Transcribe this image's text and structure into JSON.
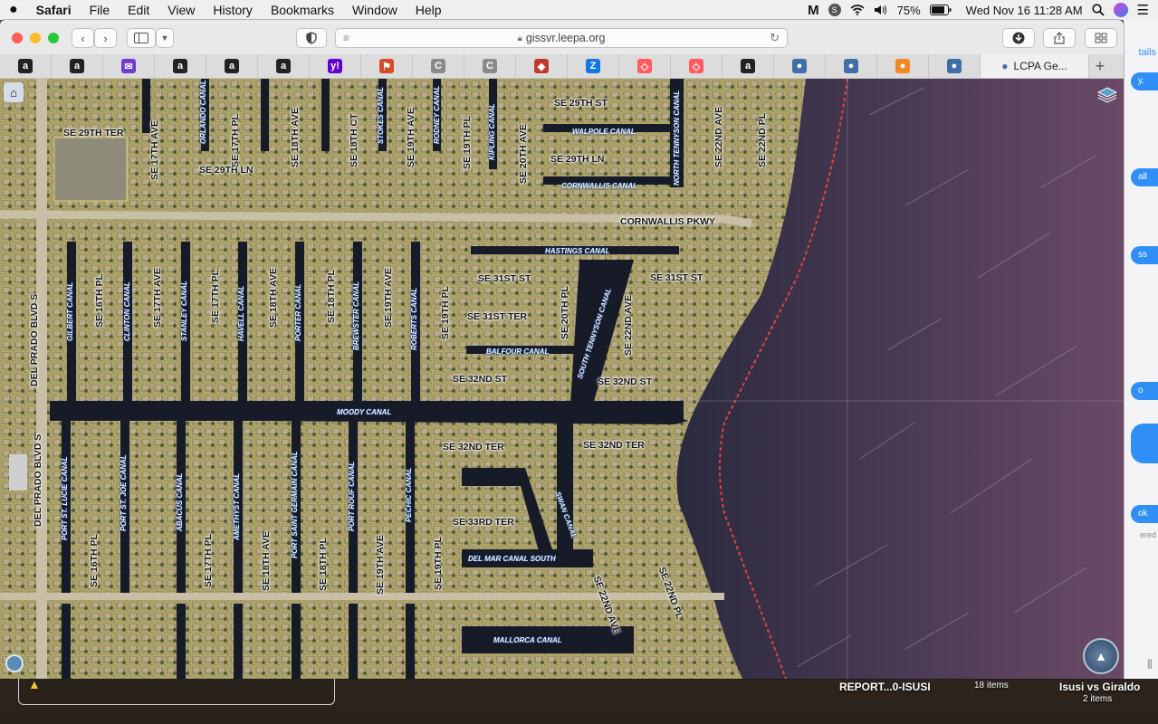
{
  "menubar": {
    "app_name": "Safari",
    "menus": [
      "File",
      "Edit",
      "View",
      "History",
      "Bookmarks",
      "Window",
      "Help"
    ],
    "battery": "75%",
    "clock": "Wed Nov 16  11:28 AM"
  },
  "browser": {
    "url": "gissvr.leepa.org",
    "active_tab_label": "LCPA Ge...",
    "favorites": [
      {
        "icon": "amazon-icon",
        "glyph": "a",
        "color": "#222222"
      },
      {
        "icon": "amazon-icon",
        "glyph": "a",
        "color": "#222222"
      },
      {
        "icon": "mail-icon",
        "glyph": "✉",
        "color": "#6f3bd1"
      },
      {
        "icon": "amazon-icon",
        "glyph": "a",
        "color": "#222222"
      },
      {
        "icon": "amazon-icon",
        "glyph": "a",
        "color": "#222222"
      },
      {
        "icon": "amazon-icon",
        "glyph": "a",
        "color": "#222222"
      },
      {
        "icon": "yahoo-icon",
        "glyph": "y!",
        "color": "#6001d2"
      },
      {
        "icon": "news-icon",
        "glyph": "⚑",
        "color": "#d94a2b"
      },
      {
        "icon": "c-icon",
        "glyph": "C",
        "color": "#8a8a8a"
      },
      {
        "icon": "c-icon",
        "glyph": "C",
        "color": "#8a8a8a"
      },
      {
        "icon": "cube-icon",
        "glyph": "◆",
        "color": "#c0392b"
      },
      {
        "icon": "zillow-icon",
        "glyph": "Z",
        "color": "#1277e1"
      },
      {
        "icon": "airbnb-icon",
        "glyph": "◇",
        "color": "#ff5a5f"
      },
      {
        "icon": "airbnb-icon",
        "glyph": "◇",
        "color": "#ff5a5f"
      },
      {
        "icon": "amazon-icon",
        "glyph": "a",
        "color": "#222222"
      },
      {
        "icon": "globe-icon",
        "glyph": "●",
        "color": "#3d6fa6"
      },
      {
        "icon": "globe-icon",
        "glyph": "●",
        "color": "#3d6fa6"
      },
      {
        "icon": "orange-icon",
        "glyph": "●",
        "color": "#f08a24"
      },
      {
        "icon": "globe-icon",
        "glyph": "●",
        "color": "#3d6fa6"
      }
    ]
  },
  "map": {
    "streets": [
      {
        "id": "st-1",
        "text": "SE 29TH TER",
        "vertical": false
      },
      {
        "id": "st-2",
        "text": "SE 29TH LN",
        "vertical": false
      },
      {
        "id": "st-3",
        "text": "SE 29TH ST",
        "vertical": false
      },
      {
        "id": "st-4",
        "text": "SE 29TH LN",
        "vertical": false
      },
      {
        "id": "st-5",
        "text": "CORNWALLIS PKWY",
        "vertical": false
      },
      {
        "id": "st-6",
        "text": "SE 31ST ST",
        "vertical": false
      },
      {
        "id": "st-7",
        "text": "SE 31ST ST",
        "vertical": false
      },
      {
        "id": "st-8",
        "text": "SE 31ST TER",
        "vertical": false
      },
      {
        "id": "st-9",
        "text": "SE 32ND ST",
        "vertical": false
      },
      {
        "id": "st-10",
        "text": "SE 32ND ST",
        "vertical": false
      },
      {
        "id": "st-11",
        "text": "SE 32ND TER",
        "vertical": false
      },
      {
        "id": "st-12",
        "text": "SE 32ND TER",
        "vertical": false
      },
      {
        "id": "st-13",
        "text": "SE 33RD TER",
        "vertical": false
      },
      {
        "id": "st-14",
        "text": "DEL PRADO BLVD S",
        "vertical": true
      },
      {
        "id": "st-15",
        "text": "DEL PRADO BLVD S",
        "vertical": true
      },
      {
        "id": "st-16",
        "text": "SE 17TH AVE",
        "vertical": true
      },
      {
        "id": "st-17",
        "text": "SE 17TH PL",
        "vertical": true
      },
      {
        "id": "st-18",
        "text": "SE 18TH AVE",
        "vertical": true
      },
      {
        "id": "st-19",
        "text": "SE 18TH CT",
        "vertical": true
      },
      {
        "id": "st-20",
        "text": "SE 19TH AVE",
        "vertical": true
      },
      {
        "id": "st-21",
        "text": "SE 19TH PL",
        "vertical": true
      },
      {
        "id": "st-22",
        "text": "SE 20TH AVE",
        "vertical": true
      },
      {
        "id": "st-23",
        "text": "SE 22ND AVE",
        "vertical": true
      },
      {
        "id": "st-24",
        "text": "SE 22ND PL",
        "vertical": true
      },
      {
        "id": "st-25",
        "text": "SE 16TH PL",
        "vertical": true
      },
      {
        "id": "st-26",
        "text": "SE 17TH AVE",
        "vertical": true
      },
      {
        "id": "st-27",
        "text": "SE 17TH PL",
        "vertical": true
      },
      {
        "id": "st-28",
        "text": "SE 18TH AVE",
        "vertical": true
      },
      {
        "id": "st-29",
        "text": "SE 18TH PL",
        "vertical": true
      },
      {
        "id": "st-30",
        "text": "SE 19TH AVE",
        "vertical": true
      },
      {
        "id": "st-31",
        "text": "SE 19TH PL",
        "vertical": true
      },
      {
        "id": "st-32",
        "text": "SE 20TH PL",
        "vertical": true
      },
      {
        "id": "st-33",
        "text": "SE 22ND AVE",
        "vertical": true
      },
      {
        "id": "st-34",
        "text": "SE 16TH PL",
        "vertical": true
      },
      {
        "id": "st-35",
        "text": "SE 17TH PL",
        "vertical": true
      },
      {
        "id": "st-36",
        "text": "SE 18TH AVE",
        "vertical": true
      },
      {
        "id": "st-37",
        "text": "SE 18TH PL",
        "vertical": true
      },
      {
        "id": "st-38",
        "text": "SE 19TH AVE",
        "vertical": true
      },
      {
        "id": "st-39",
        "text": "SE 19TH PL",
        "vertical": true
      },
      {
        "id": "st-40",
        "text": "SE 22ND AVE",
        "vertical": true
      },
      {
        "id": "st-41",
        "text": "SE 22ND PL",
        "vertical": true
      }
    ],
    "canals": [
      {
        "id": "cn-1",
        "text": "WALPOLE CANAL"
      },
      {
        "id": "cn-2",
        "text": "CORNWALLIS CANAL"
      },
      {
        "id": "cn-3",
        "text": "HASTINGS CANAL"
      },
      {
        "id": "cn-4",
        "text": "BALFOUR CANAL"
      },
      {
        "id": "cn-5",
        "text": "MOODY CANAL"
      },
      {
        "id": "cn-6",
        "text": "DEL MAR CANAL SOUTH"
      },
      {
        "id": "cn-7",
        "text": "MALLORCA CANAL"
      },
      {
        "id": "cn-8",
        "text": "NORTH TENNYSON CANAL"
      },
      {
        "id": "cn-9",
        "text": "SOUTH TENNYSON CANAL"
      },
      {
        "id": "cn-10",
        "text": "SWAN CANAL"
      },
      {
        "id": "cn-11",
        "text": "ORLANDO CANAL"
      },
      {
        "id": "cn-12",
        "text": "STOKES CANAL"
      },
      {
        "id": "cn-13",
        "text": "RODNEY CANAL"
      },
      {
        "id": "cn-14",
        "text": "KIPLING CANAL"
      },
      {
        "id": "cn-15",
        "text": "GILBERT CANAL"
      },
      {
        "id": "cn-16",
        "text": "CLINTON CANAL"
      },
      {
        "id": "cn-17",
        "text": "STANLEY CANAL"
      },
      {
        "id": "cn-18",
        "text": "HAVELL CANAL"
      },
      {
        "id": "cn-19",
        "text": "PORTER CANAL"
      },
      {
        "id": "cn-20",
        "text": "BREWSTER CANAL"
      },
      {
        "id": "cn-21",
        "text": "ROBERTS CANAL"
      },
      {
        "id": "cn-22",
        "text": "PORT ST. LUCIE CANAL"
      },
      {
        "id": "cn-23",
        "text": "PORT ST. JOE CANAL"
      },
      {
        "id": "cn-24",
        "text": "ABACUS CANAL"
      },
      {
        "id": "cn-25",
        "text": "AMETHYST CANAL"
      },
      {
        "id": "cn-26",
        "text": "PORT SAINT GERMAIN CANAL"
      },
      {
        "id": "cn-27",
        "text": "PORT ROUF CANAL"
      },
      {
        "id": "cn-28",
        "text": "PECHIC CANAL"
      }
    ]
  },
  "messages_strip": {
    "texts": [
      "tails",
      "y.",
      "all",
      "ss",
      "o",
      "ok",
      "ered"
    ]
  },
  "desktop": {
    "report_name": "REPORT...0-ISUSI",
    "folder_items": "18 items",
    "folder2_name": "Isusi vs Giraldo",
    "folder2_items": "2 items"
  }
}
